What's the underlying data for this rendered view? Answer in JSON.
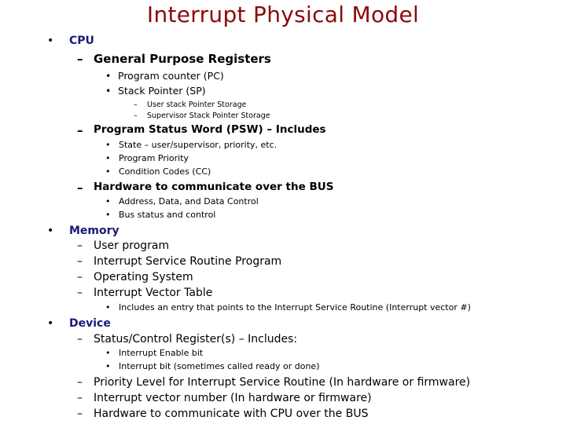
{
  "title": "Interrupt Physical Model",
  "bullets": {
    "l1": "•",
    "dash": "–",
    "l3": "•"
  },
  "cpu": {
    "label": "CPU",
    "gpr": {
      "label": "General Purpose Registers",
      "items": [
        "Program counter (PC)",
        "Stack Pointer (SP)"
      ],
      "sp_sub": [
        "User stack Pointer Storage",
        "Supervisor Stack Pointer Storage"
      ]
    },
    "psw": {
      "label": "Program Status Word (PSW) – Includes",
      "items": [
        "State – user/supervisor, priority, etc.",
        "Program Priority",
        "Condition Codes (CC)"
      ]
    },
    "hw": {
      "label": "Hardware to communicate over the BUS",
      "items": [
        "Address, Data, and Data Control",
        "Bus status and control"
      ]
    }
  },
  "memory": {
    "label": "Memory",
    "items": [
      "User program",
      "Interrupt Service Routine Program",
      "Operating System",
      "Interrupt Vector Table"
    ],
    "ivt_sub": [
      "Includes an entry that points to the Interrupt Service Routine (Interrupt vector #)"
    ]
  },
  "device": {
    "label": "Device",
    "scr": {
      "label": "Status/Control Register(s) – Includes:",
      "items": [
        "Interrupt Enable bit",
        "Interrupt bit (sometimes called ready or done)"
      ]
    },
    "items": [
      "Priority Level for Interrupt Service Routine (In hardware or firmware)",
      "Interrupt vector number (In hardware or firmware)",
      "Hardware to communicate with CPU over the BUS"
    ]
  }
}
